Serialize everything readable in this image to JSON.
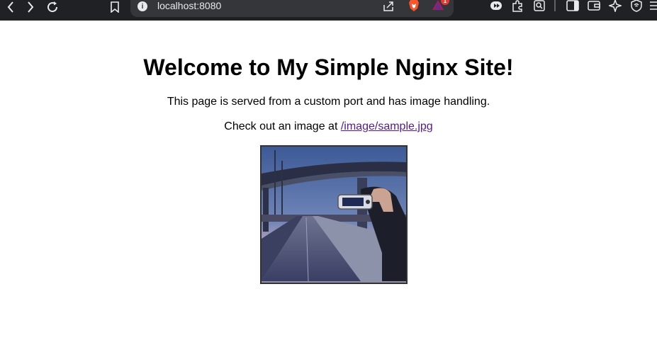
{
  "browser": {
    "url": "localhost:8080",
    "info_icon": "info-icon",
    "notification_count": "1"
  },
  "page": {
    "heading": "Welcome to My Simple Nginx Site!",
    "paragraph1": "This page is served from a custom port and has image handling.",
    "paragraph2_prefix": "Check out an image at ",
    "image_link": "/image/sample.jpg"
  }
}
